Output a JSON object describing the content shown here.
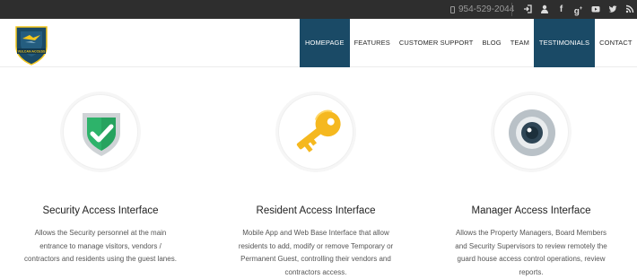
{
  "topbar": {
    "phone": "954-529-2044",
    "social_icons": [
      "login-icon",
      "user-icon",
      "facebook-icon",
      "google-plus-icon",
      "youtube-icon",
      "twitter-icon",
      "rss-icon"
    ]
  },
  "logo": {
    "text": "VULCAN ACCESS",
    "colors": {
      "shield": "#1a4a66",
      "accent": "#f3c61c"
    }
  },
  "nav": {
    "items": [
      {
        "label": "HOMEPAGE",
        "active": true
      },
      {
        "label": "FEATURES",
        "active": false
      },
      {
        "label": "CUSTOMER SUPPORT",
        "active": false
      },
      {
        "label": "BLOG",
        "active": false
      },
      {
        "label": "TEAM",
        "active": false
      },
      {
        "label": "TESTIMONIALS",
        "active": true
      },
      {
        "label": "CONTACT",
        "active": false
      }
    ],
    "active_color": "#1a4a66"
  },
  "features": [
    {
      "icon": "shield-check-icon",
      "title": "Security Access Interface",
      "text": "Allows the Security personnel at the main entrance to manage visitors, vendors / contractors and residents using the guest lanes."
    },
    {
      "icon": "key-icon",
      "title": "Resident Access Interface",
      "text": "Mobile App and Web Base Interface that allow residents to add, modify or remove Temporary or Permanent Guest, controlling their vendors and contractors access."
    },
    {
      "icon": "camera-icon",
      "title": "Manager Access Interface",
      "text": "Allows the Property Managers, Board Members and Security Supervisors to review remotely the guard house access control operations, review reports."
    }
  ]
}
